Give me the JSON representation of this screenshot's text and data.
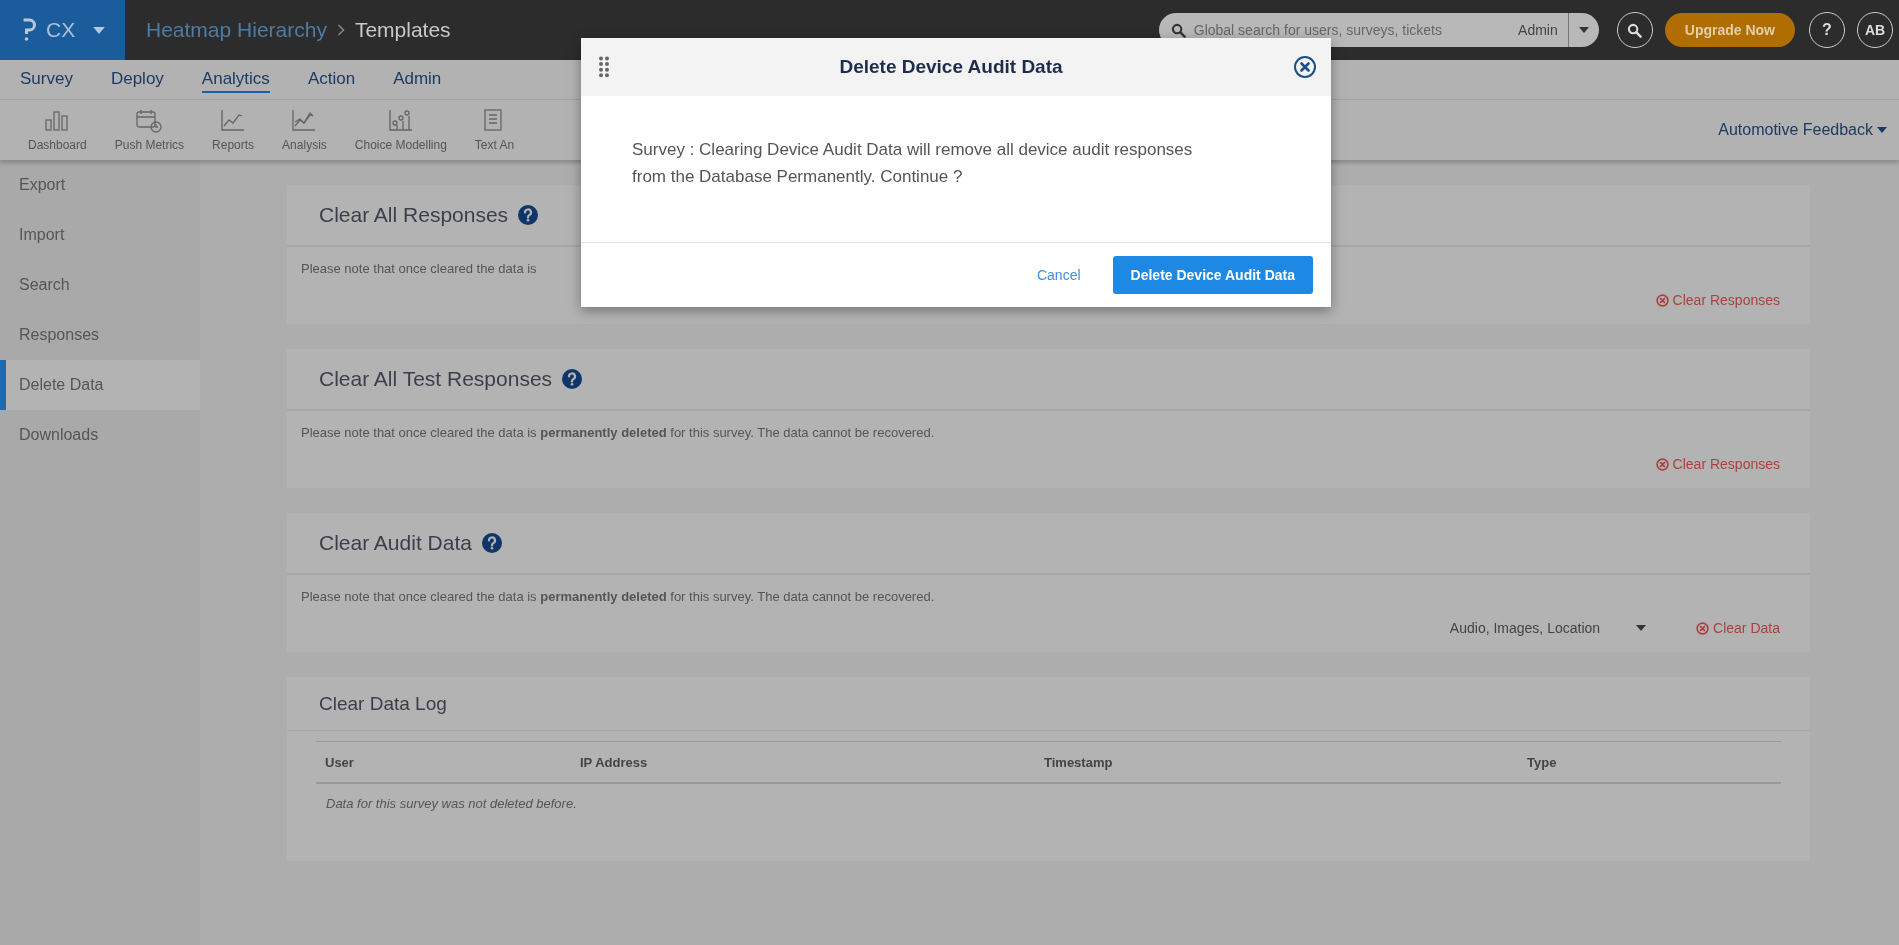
{
  "top_bar": {
    "product": "CX",
    "breadcrumb": [
      "Heatmap Hierarchy",
      "Templates"
    ],
    "search": {
      "placeholder": "Global search for users, surveys, tickets",
      "scope": "Admin"
    },
    "upgrade": "Upgrade Now",
    "help": "?",
    "avatar": "AB"
  },
  "nav": [
    {
      "label": "Survey",
      "selected": false
    },
    {
      "label": "Deploy",
      "selected": false
    },
    {
      "label": "Analytics",
      "selected": true
    },
    {
      "label": "Action",
      "selected": false
    },
    {
      "label": "Admin",
      "selected": false
    }
  ],
  "toolbar": [
    {
      "label": "Dashboard",
      "kind": "bars"
    },
    {
      "label": "Push Metrics",
      "kind": "calendar"
    },
    {
      "label": "Reports",
      "kind": "line"
    },
    {
      "label": "Analysis",
      "kind": "multiline"
    },
    {
      "label": "Choice Modelling",
      "kind": "scatter"
    },
    {
      "label": "Text An",
      "kind": "document"
    }
  ],
  "project": "Automotive Feedback",
  "sidebar": [
    {
      "label": "Export",
      "selected": false
    },
    {
      "label": "Import",
      "selected": false
    },
    {
      "label": "Search",
      "selected": false
    },
    {
      "label": "Responses",
      "selected": false
    },
    {
      "label": "Delete Data",
      "selected": true
    },
    {
      "label": "Downloads",
      "selected": false
    }
  ],
  "sections": [
    {
      "kind": "clear",
      "title": "Clear All Responses",
      "help": true,
      "note": "Please note that once cleared the data is",
      "action": "Clear Responses"
    },
    {
      "kind": "clear",
      "title": "Clear All Test Responses",
      "help": true,
      "note": "Please note that once cleared the data is **permanently deleted** for this survey. The data cannot be recovered.",
      "action": "Clear Responses"
    },
    {
      "kind": "clear",
      "title": "Clear Audit Data",
      "help": true,
      "note": "Please note that once cleared the data is **permanently deleted** for this survey. The data cannot be recovered.",
      "dropdown": "Audio, Images, Location",
      "action": "Clear Data"
    },
    {
      "kind": "log",
      "title": "Clear Data Log",
      "columns": [
        "User",
        "IP Address",
        "Timestamp",
        "Type"
      ],
      "empty_message": "Data for this survey was not deleted before."
    }
  ],
  "dialog": {
    "title": "Delete Device Audit Data",
    "message": "Survey : Clearing Device Audit Data will remove all device audit responses from the Database Permanently. Continue ?",
    "buttons": [
      {
        "label": "Cancel",
        "kind": "link"
      },
      {
        "label": "Delete Device Audit Data",
        "kind": "primary"
      }
    ]
  }
}
